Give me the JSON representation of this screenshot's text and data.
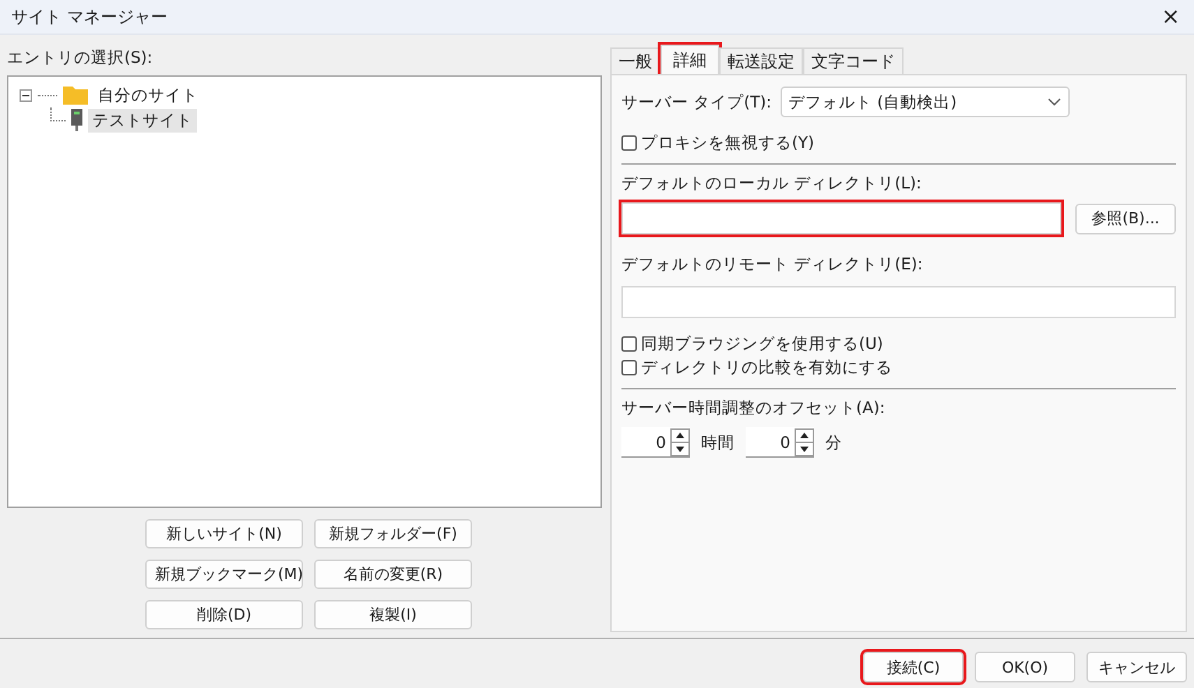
{
  "window": {
    "title": "サイト マネージャー",
    "close": "×"
  },
  "entries": {
    "label": "エントリの選択(S):",
    "tree": [
      {
        "label": "自分のサイト",
        "kind": "folder",
        "expanded": true,
        "selected": false,
        "children": [
          {
            "label": "テストサイト",
            "kind": "site",
            "selected": true
          }
        ]
      }
    ]
  },
  "entry_buttons": [
    {
      "label": "新しいサイト(N)"
    },
    {
      "label": "新規フォルダー(F)"
    },
    {
      "label": "新規ブックマーク(M)"
    },
    {
      "label": "名前の変更(R)"
    },
    {
      "label": "削除(D)"
    },
    {
      "label": "複製(I)"
    }
  ],
  "tabs": [
    {
      "label": "一般",
      "selected": false,
      "highlighted": false
    },
    {
      "label": "詳細",
      "selected": true,
      "highlighted": true
    },
    {
      "label": "転送設定",
      "selected": false,
      "highlighted": false
    },
    {
      "label": "文字コード",
      "selected": false,
      "highlighted": false
    }
  ],
  "server_type": {
    "label": "サーバー タイプ(T):",
    "value": "デフォルト (自動検出)"
  },
  "proxy": {
    "label": "プロキシを無視する(Y)",
    "checked": false
  },
  "local_dir": {
    "label": "デフォルトのローカル ディレクトリ(L):",
    "highlighted": true,
    "browse": "参照(B)..."
  },
  "remote_dir": {
    "label": "デフォルトのリモート ディレクトリ(E):",
    "highlighted": false
  },
  "options": [
    {
      "label": "同期ブラウジングを使用する(U)",
      "checked": false
    },
    {
      "label": "ディレクトリの比較を有効にする",
      "checked": false
    }
  ],
  "offset": {
    "label": "サーバー時間調整のオフセット(A):",
    "spinners": [
      {
        "value": "0",
        "unit": "時間"
      },
      {
        "value": "0",
        "unit": "分"
      }
    ]
  },
  "footer_buttons": [
    {
      "label": "接続(C)",
      "highlighted": true
    },
    {
      "label": "OK(O)",
      "highlighted": false
    },
    {
      "label": "キャンセル",
      "highlighted": false
    }
  ]
}
